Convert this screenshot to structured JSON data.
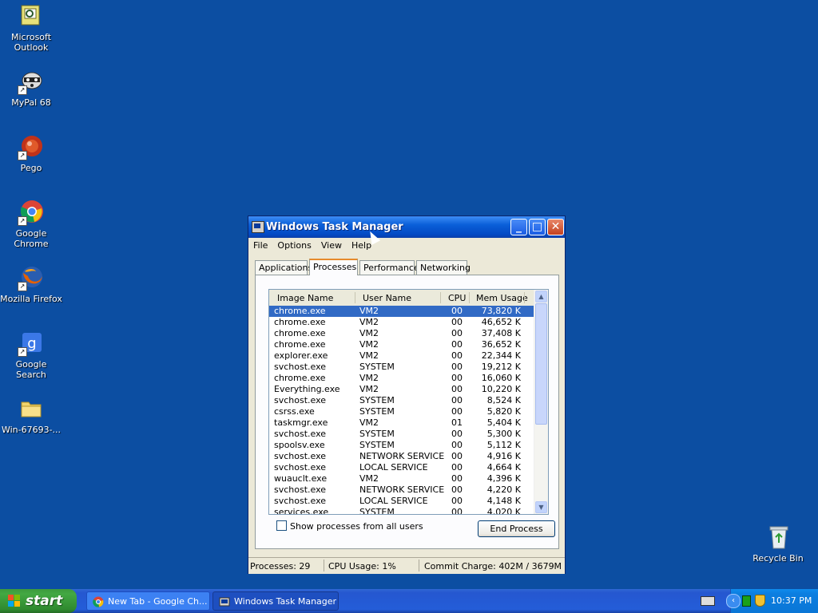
{
  "desktop": {
    "icons": [
      {
        "label1": "Microsoft",
        "label2": "Outlook"
      },
      {
        "label1": "MyPal 68"
      },
      {
        "label1": "Pego"
      },
      {
        "label1": "Google Chrome"
      },
      {
        "label1": "Mozilla Firefox"
      },
      {
        "label1": "Google Search"
      },
      {
        "label1": "Win-67693-..."
      },
      {
        "label1": "Recycle Bin"
      }
    ],
    "background": "#0c4ea2"
  },
  "window": {
    "title": "Windows Task Manager",
    "menu": [
      "File",
      "Options",
      "View",
      "Help"
    ],
    "tabs": [
      "Applications",
      "Processes",
      "Performance",
      "Networking"
    ],
    "active_tab": "Processes",
    "columns": {
      "image": "Image Name",
      "user": "User Name",
      "cpu": "CPU",
      "mem": "Mem Usage"
    },
    "processes": [
      {
        "image": "chrome.exe",
        "user": "VM2",
        "cpu": "00",
        "mem": "73,820 K"
      },
      {
        "image": "chrome.exe",
        "user": "VM2",
        "cpu": "00",
        "mem": "46,652 K"
      },
      {
        "image": "chrome.exe",
        "user": "VM2",
        "cpu": "00",
        "mem": "37,408 K"
      },
      {
        "image": "chrome.exe",
        "user": "VM2",
        "cpu": "00",
        "mem": "36,652 K"
      },
      {
        "image": "explorer.exe",
        "user": "VM2",
        "cpu": "00",
        "mem": "22,344 K"
      },
      {
        "image": "svchost.exe",
        "user": "SYSTEM",
        "cpu": "00",
        "mem": "19,212 K"
      },
      {
        "image": "chrome.exe",
        "user": "VM2",
        "cpu": "00",
        "mem": "16,060 K"
      },
      {
        "image": "Everything.exe",
        "user": "VM2",
        "cpu": "00",
        "mem": "10,220 K"
      },
      {
        "image": "svchost.exe",
        "user": "SYSTEM",
        "cpu": "00",
        "mem": "8,524 K"
      },
      {
        "image": "csrss.exe",
        "user": "SYSTEM",
        "cpu": "00",
        "mem": "5,820 K"
      },
      {
        "image": "taskmgr.exe",
        "user": "VM2",
        "cpu": "01",
        "mem": "5,404 K"
      },
      {
        "image": "svchost.exe",
        "user": "SYSTEM",
        "cpu": "00",
        "mem": "5,300 K"
      },
      {
        "image": "spoolsv.exe",
        "user": "SYSTEM",
        "cpu": "00",
        "mem": "5,112 K"
      },
      {
        "image": "svchost.exe",
        "user": "NETWORK SERVICE",
        "cpu": "00",
        "mem": "4,916 K"
      },
      {
        "image": "svchost.exe",
        "user": "LOCAL SERVICE",
        "cpu": "00",
        "mem": "4,664 K"
      },
      {
        "image": "wuauclt.exe",
        "user": "VM2",
        "cpu": "00",
        "mem": "4,396 K"
      },
      {
        "image": "svchost.exe",
        "user": "NETWORK SERVICE",
        "cpu": "00",
        "mem": "4,220 K"
      },
      {
        "image": "svchost.exe",
        "user": "LOCAL SERVICE",
        "cpu": "00",
        "mem": "4,148 K"
      },
      {
        "image": "services.exe",
        "user": "SYSTEM",
        "cpu": "00",
        "mem": "4,020 K"
      }
    ],
    "selected_row": 0,
    "show_all_label": "Show processes from all users",
    "show_all_checked": false,
    "end_process_label": "End Process",
    "status": {
      "processes": "Processes: 29",
      "cpu": "CPU Usage: 1%",
      "commit": "Commit Charge: 402M / 3679M"
    }
  },
  "taskbar": {
    "start_label": "start",
    "tasks": [
      {
        "label": "New Tab - Google Ch..."
      },
      {
        "label": "Windows Task Manager"
      }
    ],
    "clock": "10:37 PM"
  }
}
